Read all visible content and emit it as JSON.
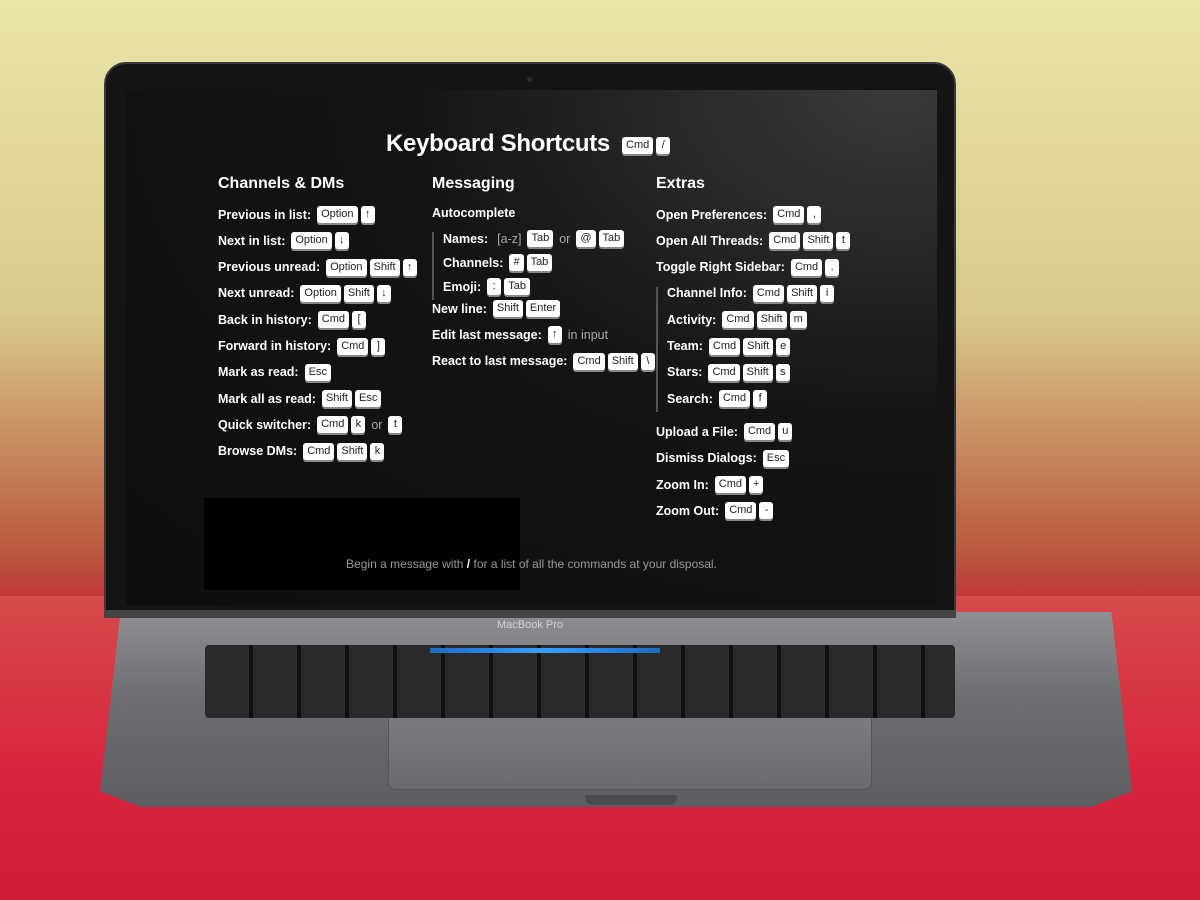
{
  "device_label": "MacBook Pro",
  "title": "Keyboard Shortcuts",
  "title_keys": [
    "Cmd",
    "/"
  ],
  "columns": [
    {
      "heading": "Channels & DMs",
      "rows": [
        {
          "label": "Previous in list:",
          "tokens": [
            {
              "k": "Option"
            },
            {
              "k": "↑"
            }
          ]
        },
        {
          "label": "Next in list:",
          "tokens": [
            {
              "k": "Option"
            },
            {
              "k": "↓"
            }
          ]
        },
        {
          "label": "Previous unread:",
          "tokens": [
            {
              "k": "Option"
            },
            {
              "k": "Shift"
            },
            {
              "k": "↑"
            }
          ]
        },
        {
          "label": "Next unread:",
          "tokens": [
            {
              "k": "Option"
            },
            {
              "k": "Shift"
            },
            {
              "k": "↓"
            }
          ]
        },
        {
          "label": "Back in history:",
          "tokens": [
            {
              "k": "Cmd"
            },
            {
              "k": "["
            }
          ]
        },
        {
          "label": "Forward in history:",
          "tokens": [
            {
              "k": "Cmd"
            },
            {
              "k": "]"
            }
          ]
        },
        {
          "label": "Mark as read:",
          "tokens": [
            {
              "k": "Esc"
            }
          ]
        },
        {
          "label": "Mark all as read:",
          "tokens": [
            {
              "k": "Shift"
            },
            {
              "k": "Esc"
            }
          ]
        },
        {
          "label": "Quick switcher:",
          "tokens": [
            {
              "k": "Cmd"
            },
            {
              "k": "k"
            },
            {
              "t": "or"
            },
            {
              "k": "t"
            }
          ]
        },
        {
          "label": "Browse DMs:",
          "tokens": [
            {
              "k": "Cmd"
            },
            {
              "k": "Shift"
            },
            {
              "k": "k"
            }
          ]
        }
      ]
    },
    {
      "heading": "Messaging",
      "rows": [
        {
          "label": "Autocomplete",
          "tokens": []
        },
        {
          "label": "Names:",
          "indent": true,
          "tokens": [
            {
              "t": "[a-z]"
            },
            {
              "k": "Tab"
            },
            {
              "t": "or"
            },
            {
              "k": "@"
            },
            {
              "k": "Tab"
            }
          ]
        },
        {
          "label": "Channels:",
          "indent": true,
          "tokens": [
            {
              "k": "#"
            },
            {
              "k": "Tab"
            }
          ]
        },
        {
          "label": "Emoji:",
          "indent": true,
          "tokens": [
            {
              "k": ":"
            },
            {
              "k": "Tab"
            }
          ]
        },
        {
          "label": "New line:",
          "tokens": [
            {
              "k": "Shift"
            },
            {
              "k": "Enter"
            }
          ]
        },
        {
          "label": "Edit last message:",
          "tokens": [
            {
              "k": "↑"
            },
            {
              "t": "in input"
            }
          ]
        },
        {
          "label": "React to last message:",
          "tokens": [
            {
              "k": "Cmd"
            },
            {
              "k": "Shift"
            },
            {
              "k": "\\"
            }
          ]
        }
      ]
    },
    {
      "heading": "Extras",
      "rows": [
        {
          "label": "Open Preferences:",
          "tokens": [
            {
              "k": "Cmd"
            },
            {
              "k": ","
            }
          ]
        },
        {
          "label": "Open All Threads:",
          "tokens": [
            {
              "k": "Cmd"
            },
            {
              "k": "Shift"
            },
            {
              "k": "t"
            }
          ]
        },
        {
          "label": "Toggle Right Sidebar:",
          "tokens": [
            {
              "k": "Cmd"
            },
            {
              "k": "."
            }
          ]
        },
        {
          "label": "Channel Info:",
          "indent": true,
          "tokens": [
            {
              "k": "Cmd"
            },
            {
              "k": "Shift"
            },
            {
              "k": "i"
            }
          ]
        },
        {
          "label": "Activity:",
          "indent": true,
          "tokens": [
            {
              "k": "Cmd"
            },
            {
              "k": "Shift"
            },
            {
              "k": "m"
            }
          ]
        },
        {
          "label": "Team:",
          "indent": true,
          "tokens": [
            {
              "k": "Cmd"
            },
            {
              "k": "Shift"
            },
            {
              "k": "e"
            }
          ]
        },
        {
          "label": "Stars:",
          "indent": true,
          "tokens": [
            {
              "k": "Cmd"
            },
            {
              "k": "Shift"
            },
            {
              "k": "s"
            }
          ]
        },
        {
          "label": "Search:",
          "indent": true,
          "tokens": [
            {
              "k": "Cmd"
            },
            {
              "k": "f"
            }
          ]
        },
        {
          "label": "Upload a File:",
          "tokens": [
            {
              "k": "Cmd"
            },
            {
              "k": "u"
            }
          ]
        },
        {
          "label": "Dismiss Dialogs:",
          "tokens": [
            {
              "k": "Esc"
            }
          ]
        },
        {
          "label": "Zoom In:",
          "tokens": [
            {
              "k": "Cmd"
            },
            {
              "k": "+"
            }
          ]
        },
        {
          "label": "Zoom Out:",
          "tokens": [
            {
              "k": "Cmd"
            },
            {
              "k": "-"
            }
          ]
        }
      ]
    }
  ],
  "footer": {
    "before": "Begin a message with",
    "slash": "/",
    "after": "for a list of all the commands at your disposal."
  }
}
